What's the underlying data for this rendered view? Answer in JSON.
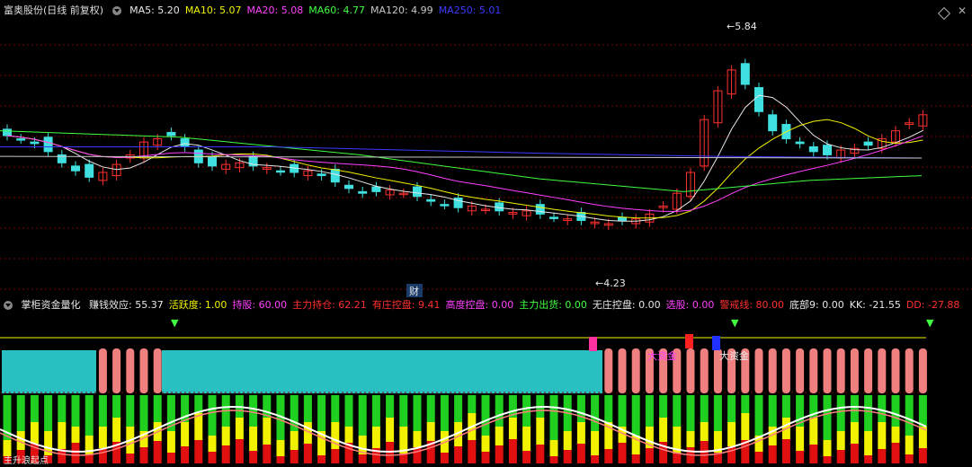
{
  "main_title": "富奥股份(日线 前复权)",
  "ma": [
    {
      "label": "MA5: 5.20",
      "color": "#e8e8e8"
    },
    {
      "label": "MA10: 5.07",
      "color": "#f2f200"
    },
    {
      "label": "MA20: 5.08",
      "color": "#ff40ff"
    },
    {
      "label": "MA60: 4.77",
      "color": "#40ff40"
    },
    {
      "label": "MA120: 4.99",
      "color": "#c8c8c8"
    },
    {
      "label": "MA250: 5.01",
      "color": "#3b3bff"
    }
  ],
  "price_high_label": "5.84",
  "price_low_label": "4.23",
  "event_label": "财",
  "indicator_title": "掌柜资金量化",
  "indicators": [
    {
      "name": "赚钱效应",
      "value": "55.37",
      "color": "#e8e8e8"
    },
    {
      "name": "活跃度",
      "value": "1.00",
      "color": "#f2f200"
    },
    {
      "name": "持股",
      "value": "60.00",
      "color": "#ff40ff"
    },
    {
      "name": "主力持仓",
      "value": "62.21",
      "color": "#ff3030"
    },
    {
      "name": "有庄控盘",
      "value": "9.41",
      "color": "#ff3030"
    },
    {
      "name": "高度控盘",
      "value": "0.00",
      "color": "#ff40ff"
    },
    {
      "name": "主力出货",
      "value": "0.00",
      "color": "#40ff40"
    },
    {
      "name": "无庄控盘",
      "value": "0.00",
      "color": "#e8e8e8"
    },
    {
      "name": "选股",
      "value": "0.00",
      "color": "#ff40ff"
    },
    {
      "name": "警戒线",
      "value": "80.00",
      "color": "#ff3030"
    },
    {
      "name": "底部9",
      "value": "0.00",
      "color": "#e8e8e8"
    },
    {
      "name": "KK",
      "value": "-21.55",
      "color": "#e8e8e8"
    },
    {
      "name": "DD",
      "value": "-27.88",
      "color": "#ff3030"
    }
  ],
  "annotations": {
    "big_money_1": "大资金",
    "big_money_2": "大资金"
  },
  "bottom_text": "主升浪起点",
  "colors": {
    "up": "#ff3030",
    "down": "#40e0e0",
    "grid": "#7a0000",
    "ma5": "#e8e8e8",
    "ma10": "#f2f200",
    "ma20": "#ff40ff",
    "ma60": "#40ff40",
    "ma250": "#3b3bff"
  }
}
